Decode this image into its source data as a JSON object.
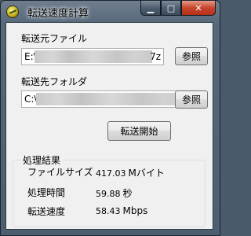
{
  "window": {
    "title": "転送速度計算",
    "icon": "speed-meter-icon",
    "caption_buttons": {
      "minimize": "▁",
      "maximize": "□",
      "close": "✕"
    }
  },
  "source": {
    "label": "転送元ファイル",
    "value_start": "E:\\",
    "value_end": "7z",
    "browse_label": "参照"
  },
  "destination": {
    "label": "転送先フォルダ",
    "value_start": "C:\\",
    "browse_label": "参照"
  },
  "start_button": {
    "label": "転送開始"
  },
  "results": {
    "group_title": "処理結果",
    "file_size": {
      "label": "ファイルサイズ",
      "value": "417.03",
      "unit": "Mバイト"
    },
    "elapsed": {
      "label": "処理時間",
      "value": "59.88",
      "unit": "秒"
    },
    "speed": {
      "label": "転送速度",
      "value": "58.43",
      "unit": "Mbps"
    }
  },
  "colors": {
    "dialog_bg": "#f0f0f0",
    "close_button": "#c7452b",
    "title_bar": "#56687a"
  }
}
